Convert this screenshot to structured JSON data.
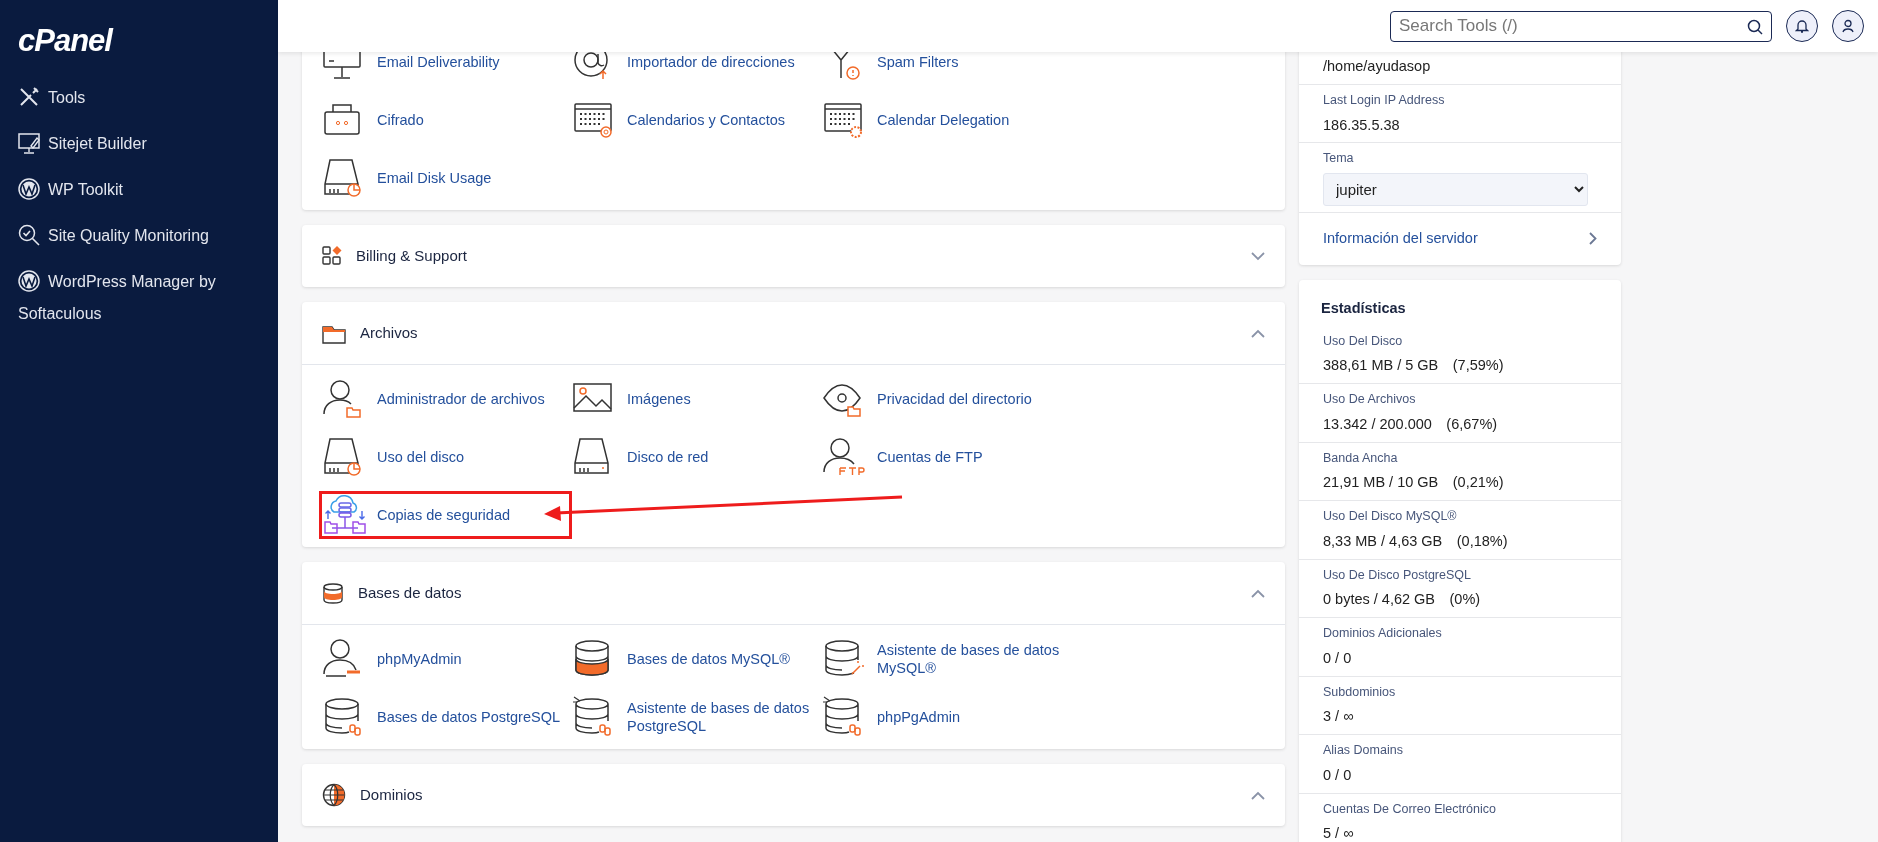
{
  "sidebar": {
    "logo": "cPanel",
    "items": [
      {
        "label": "Tools"
      },
      {
        "label": "Sitejet Builder"
      },
      {
        "label": "WP Toolkit"
      },
      {
        "label": "Site Quality Monitoring"
      },
      {
        "label": "WordPress Manager by Softaculous"
      }
    ]
  },
  "topbar": {
    "search": {
      "placeholder": "Search Tools (/)"
    }
  },
  "sections": [
    {
      "tools": [
        {
          "label": "Email Deliverability",
          "highlighted": false
        },
        {
          "label": "Importador de direcciones",
          "highlighted": false
        },
        {
          "label": "Spam Filters",
          "highlighted": false
        },
        {
          "label": "Cifrado",
          "highlighted": false
        },
        {
          "label": "Calendarios y Contactos",
          "highlighted": false
        },
        {
          "label": "Calendar Delegation",
          "highlighted": false
        },
        {
          "label": "Email Disk Usage",
          "highlighted": false
        }
      ]
    },
    {
      "title": "Billing & Support",
      "expanded": false
    },
    {
      "title": "Archivos",
      "expanded": true,
      "tools": [
        {
          "label": "Administrador de archivos",
          "highlighted": false
        },
        {
          "label": "Imágenes",
          "highlighted": false
        },
        {
          "label": "Privacidad del directorio",
          "highlighted": false
        },
        {
          "label": "Uso del disco",
          "highlighted": false
        },
        {
          "label": "Disco de red",
          "highlighted": false
        },
        {
          "label": "Cuentas de FTP",
          "highlighted": false
        },
        {
          "label": "Copias de seguridad",
          "highlighted": true
        }
      ]
    },
    {
      "title": "Bases de datos",
      "expanded": true,
      "tools": [
        {
          "label": "phpMyAdmin",
          "highlighted": false
        },
        {
          "label": "Bases de datos MySQL®",
          "highlighted": false
        },
        {
          "label": "Asistente de bases de datos MySQL®",
          "highlighted": false
        },
        {
          "label": "Bases de datos PostgreSQL",
          "highlighted": false
        },
        {
          "label": "Asistente de bases de datos PostgreSQL",
          "highlighted": false
        },
        {
          "label": "phpPgAdmin",
          "highlighted": false
        }
      ]
    },
    {
      "title": "Dominios",
      "expanded": true
    }
  ],
  "general_info": {
    "rows": [
      {
        "value": "/home/ayudasop"
      },
      {
        "label": "Last Login IP Address",
        "value": "186.35.5.38"
      }
    ],
    "theme": {
      "label": "Tema",
      "value": "jupiter"
    },
    "server_info_link": "Información del servidor"
  },
  "statistics": {
    "title": "Estadísticas",
    "items": [
      {
        "label": "Uso Del Disco",
        "value": "388,61 MB / 5 GB",
        "percent": "(7,59%)"
      },
      {
        "label": "Uso De Archivos",
        "value": "13.342 / 200.000",
        "percent": "(6,67%)"
      },
      {
        "label": "Banda Ancha",
        "value": "21,91 MB / 10 GB",
        "percent": "(0,21%)"
      },
      {
        "label": "Uso Del Disco MySQL®",
        "value": "8,33 MB / 4,63 GB",
        "percent": "(0,18%)"
      },
      {
        "label": "Uso De Disco PostgreSQL",
        "value": "0 bytes / 4,62 GB",
        "percent": "(0%)"
      },
      {
        "label": "Dominios Adicionales",
        "value": "0 / 0"
      },
      {
        "label": "Subdominios",
        "value": "3 / ∞"
      },
      {
        "label": "Alias Domains",
        "value": "0 / 0"
      },
      {
        "label": "Cuentas De Correo Electrónico",
        "value": "5 / ∞"
      }
    ]
  }
}
